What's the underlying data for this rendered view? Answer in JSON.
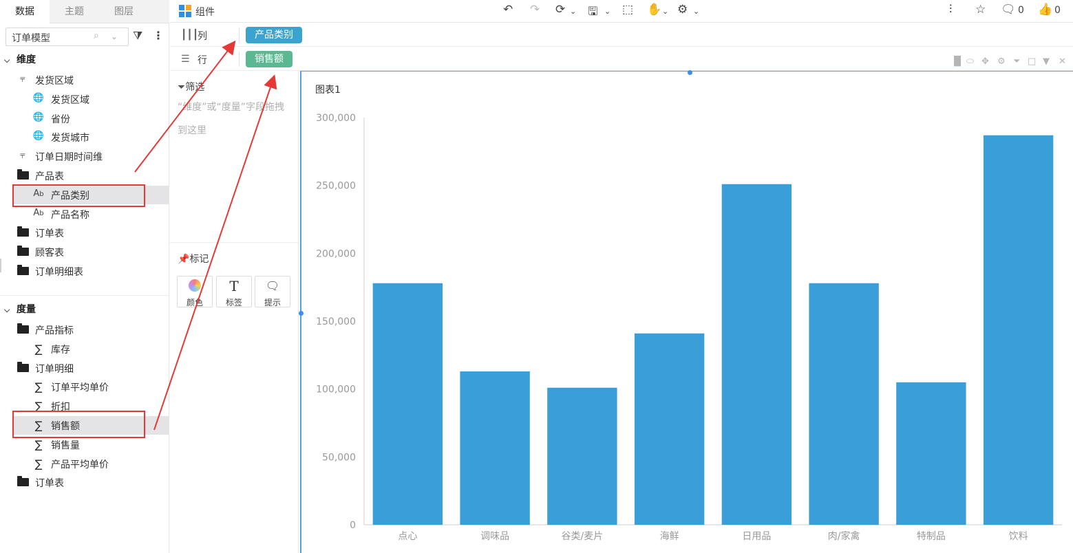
{
  "left_tabs": [
    "数据",
    "主题",
    "图层"
  ],
  "search": {
    "value": "订单模型"
  },
  "dimension": {
    "header": "维度",
    "items": [
      {
        "label": "发货区域",
        "icon": "hierarchy-icon",
        "indent": 0
      },
      {
        "label": "发货区域",
        "icon": "globe-icon",
        "indent": 1
      },
      {
        "label": "省份",
        "icon": "globe-icon",
        "indent": 1
      },
      {
        "label": "发货城市",
        "icon": "globe-icon",
        "indent": 1
      },
      {
        "label": "订单日期时间维",
        "icon": "hierarchy-icon",
        "indent": 0
      },
      {
        "label": "产品表",
        "icon": "folder-icon",
        "indent": 0
      },
      {
        "label": "产品类别",
        "icon": "text-field-icon",
        "indent": 1,
        "selected": true
      },
      {
        "label": "产品名称",
        "icon": "text-field-icon",
        "indent": 1
      },
      {
        "label": "订单表",
        "icon": "folder-icon",
        "indent": 0
      },
      {
        "label": "顾客表",
        "icon": "folder-icon",
        "indent": 0
      },
      {
        "label": "订单明细表",
        "icon": "folder-icon",
        "indent": 0
      }
    ]
  },
  "measure": {
    "header": "度量",
    "items": [
      {
        "label": "产品指标",
        "icon": "folder-icon",
        "indent": 0
      },
      {
        "label": "库存",
        "icon": "sigma-icon",
        "indent": 1
      },
      {
        "label": "订单明细",
        "icon": "folder-icon",
        "indent": 0
      },
      {
        "label": "订单平均单价",
        "icon": "sigma-icon",
        "indent": 1
      },
      {
        "label": "折扣",
        "icon": "sigma-icon",
        "indent": 1
      },
      {
        "label": "销售额",
        "icon": "sigma-icon",
        "indent": 1,
        "selected": true
      },
      {
        "label": "销售量",
        "icon": "sigma-icon",
        "indent": 1
      },
      {
        "label": "产品平均单价",
        "icon": "sigma-icon",
        "indent": 1
      },
      {
        "label": "订单表",
        "icon": "folder-icon",
        "indent": 0
      }
    ]
  },
  "toolbar": {
    "component_label": "组件",
    "comment_count": "0",
    "like_count": "0"
  },
  "shelves": {
    "column": {
      "label": "列",
      "pill": "产品类别",
      "color": "#3aa3cf"
    },
    "row": {
      "label": "行",
      "pill": "销售额",
      "color": "#5cb891"
    }
  },
  "filter": {
    "title": "筛选",
    "hint": "“维度”或“度量”字段拖拽到这里"
  },
  "marks": {
    "title": "标记",
    "buttons": [
      "颜色",
      "标签",
      "提示"
    ]
  },
  "chart_title": "图表1",
  "colors": {
    "bar": "#3a9fd8",
    "accent": "#4ea3f0",
    "annotation": "#e53935"
  },
  "chart_data": {
    "type": "bar",
    "categories": [
      "点心",
      "调味品",
      "谷类/麦片",
      "海鲜",
      "日用品",
      "肉/家禽",
      "特制品",
      "饮料"
    ],
    "values": [
      178000,
      113000,
      101000,
      141000,
      251000,
      178000,
      105000,
      287000
    ],
    "y_ticks": [
      "0",
      "50,000",
      "100,000",
      "150,000",
      "200,000",
      "250,000",
      "300,000"
    ],
    "ylim": [
      0,
      300000
    ],
    "grid": false,
    "legend": "none"
  }
}
